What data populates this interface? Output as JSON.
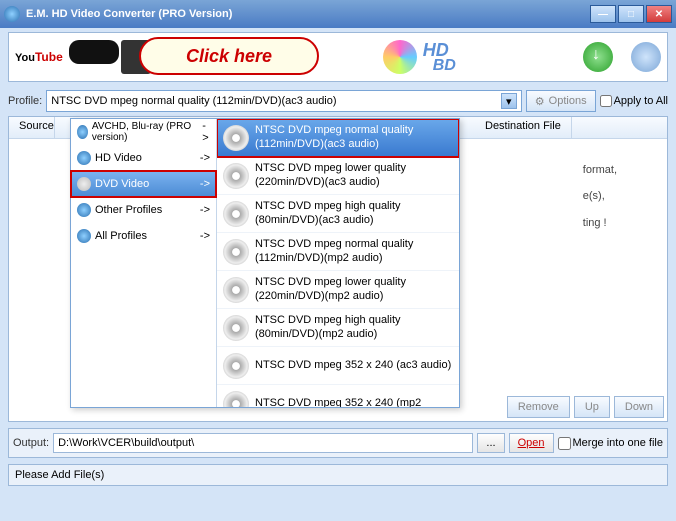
{
  "window": {
    "title": "E.M. HD Video Converter (PRO Version)"
  },
  "annotation": {
    "bubble": "Click here"
  },
  "banner": {
    "hd": "HD",
    "bd": "BD",
    "yt": "YouTube"
  },
  "profile": {
    "label": "Profile:",
    "selected": "NTSC DVD mpeg normal quality (112min/DVD)(ac3 audio)",
    "options_btn": "Options",
    "apply_all": "Apply to All"
  },
  "columns": {
    "source": "Source",
    "dest": "Destination File"
  },
  "hints": {
    "l1": "format,",
    "l2": "e(s),",
    "l3": "ting !"
  },
  "dropdown": {
    "categories": [
      {
        "label": "AVCHD, Blu-ray (PRO version)",
        "arrow": "->",
        "multiline": true
      },
      {
        "label": "HD Video",
        "arrow": "->"
      },
      {
        "label": "DVD Video",
        "arrow": "->",
        "selected": true,
        "boxed": true
      },
      {
        "label": "Other Profiles",
        "arrow": "->"
      },
      {
        "label": "All Profiles",
        "arrow": "->"
      }
    ],
    "items": [
      {
        "label": "NTSC DVD mpeg normal quality (112min/DVD)(ac3 audio)",
        "selected": true,
        "boxed": true
      },
      {
        "label": "NTSC DVD mpeg lower quality (220min/DVD)(ac3 audio)"
      },
      {
        "label": "NTSC DVD mpeg high quality (80min/DVD)(ac3 audio)"
      },
      {
        "label": "NTSC DVD mpeg normal quality (112min/DVD)(mp2 audio)"
      },
      {
        "label": "NTSC DVD mpeg lower quality (220min/DVD)(mp2 audio)"
      },
      {
        "label": "NTSC DVD mpeg high quality (80min/DVD)(mp2 audio)"
      },
      {
        "label": "NTSC DVD mpeg 352 x 240 (ac3 audio)"
      },
      {
        "label": "NTSC DVD mpeg 352 x 240 (mp2"
      }
    ]
  },
  "action_buttons": {
    "remove": "Remove",
    "up": "Up",
    "down": "Down"
  },
  "output": {
    "label": "Output:",
    "path": "D:\\Work\\VCER\\build\\output\\",
    "browse": "...",
    "open": "Open",
    "merge": "Merge into one file"
  },
  "status": {
    "text": "Please Add File(s)"
  }
}
